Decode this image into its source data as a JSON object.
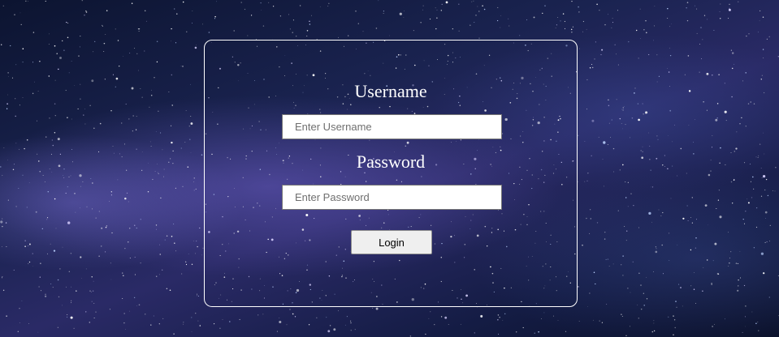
{
  "form": {
    "username_label": "Username",
    "username_placeholder": "Enter Username",
    "password_label": "Password",
    "password_placeholder": "Enter Password",
    "login_label": "Login"
  },
  "colors": {
    "background": "#1a2350",
    "card_border": "#ffffff",
    "label_text": "#ffffff",
    "button_bg": "#efefef"
  }
}
